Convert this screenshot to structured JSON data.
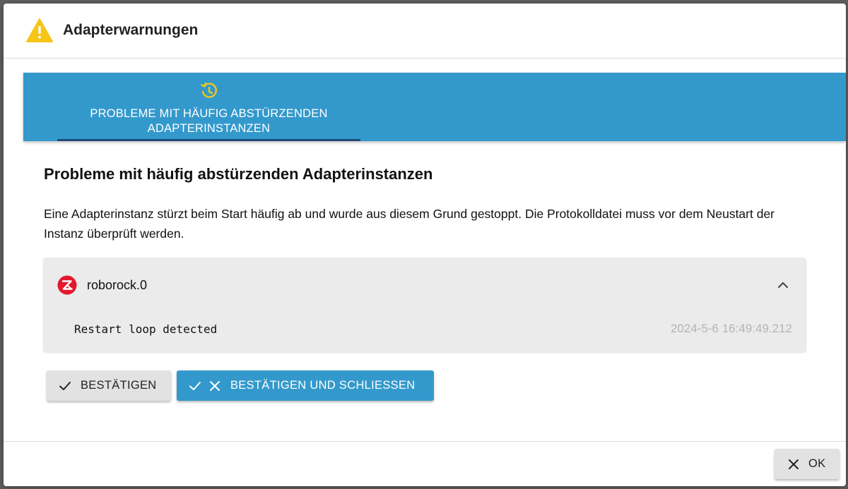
{
  "dialog": {
    "title": "Adapterwarnungen",
    "icon": "warning-icon",
    "accent_color": "#3399cc",
    "warning_color": "#f5c518"
  },
  "tabs": [
    {
      "label": "PROBLEME MIT HÄUFIG ABSTÜRZENDEN ADAPTERINSTANZEN",
      "icon": "restart-history-icon",
      "selected": true
    }
  ],
  "content": {
    "title": "Probleme mit häufig abstürzenden Adapterinstanzen",
    "description": "Eine Adapterinstanz stürzt beim Start häufig ab und wurde aus diesem Grund gestoppt. Die Protokolldatei muss vor dem Neustart der Instanz überprüft werden."
  },
  "instance": {
    "name": "roborock.0",
    "logo": "roborock-logo",
    "expanded": true,
    "message": "Restart loop detected",
    "timestamp": "2024-5-6 16:49:49.212"
  },
  "actions": {
    "acknowledge": "BESTÄTIGEN",
    "acknowledge_close": "BESTÄTIGEN UND SCHLIESSEN",
    "ok": "OK"
  }
}
